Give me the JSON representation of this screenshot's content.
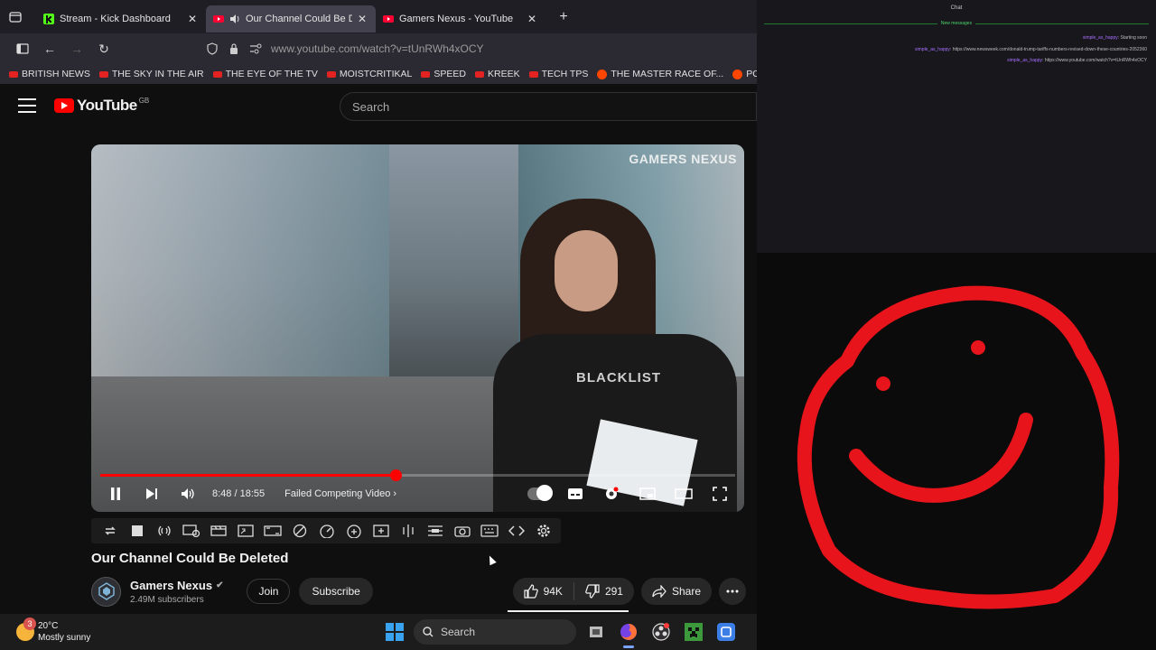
{
  "browser": {
    "tabs": [
      {
        "label": "Stream - Kick Dashboard",
        "favicon": "kick-icon"
      },
      {
        "label": "Our Channel Could Be Deleted",
        "favicon": "youtube-icon",
        "audio": true
      },
      {
        "label": "Gamers Nexus - YouTube",
        "favicon": "youtube-icon"
      }
    ],
    "active_tab": 1,
    "url": "www.youtube.com/watch?v=tUnRWh4xOCY",
    "bookmarks": [
      {
        "label": "BRITISH NEWS",
        "icon": "youtube"
      },
      {
        "label": "THE SKY IN THE AIR",
        "icon": "youtube"
      },
      {
        "label": "THE EYE OF THE TV",
        "icon": "youtube"
      },
      {
        "label": "MOISTCRITIKAL",
        "icon": "youtube"
      },
      {
        "label": "SPEED",
        "icon": "youtube"
      },
      {
        "label": "KREEK",
        "icon": "youtube"
      },
      {
        "label": "TECH TPS",
        "icon": "youtube"
      },
      {
        "label": "THE MASTER RACE OF...",
        "icon": "reddit"
      },
      {
        "label": "POLITICAL STUFF",
        "icon": "reddit"
      }
    ]
  },
  "youtube": {
    "logo_text": "YouTube",
    "country": "GB",
    "search_placeholder": "Search",
    "player": {
      "watermark": "GAMERS NEXUS",
      "shirt_text": "BLACKLIST",
      "time": "8:48 / 18:55",
      "chapter": "Failed Competing Video",
      "progress_fraction": 0.465
    },
    "video": {
      "title": "Our Channel Could Be Deleted",
      "channel": "Gamers Nexus",
      "subscribers": "2.49M subscribers",
      "join_label": "Join",
      "subscribe_label": "Subscribe",
      "likes": "94K",
      "dislikes": "291",
      "share_label": "Share"
    }
  },
  "chat": {
    "title": "Chat",
    "new_messages": "New messages",
    "lines": [
      {
        "user": "simple_as_happy",
        "text": "Starting soon"
      },
      {
        "user": "simple_as_happy",
        "text": "https://www.newsweek.com/donald-trump-tariffs-numbers-revised-down-these-countries-2052360"
      },
      {
        "user": "simple_as_happy",
        "text": "https://www.youtube.com/watch?v=tUnRWh4xOCY"
      }
    ]
  },
  "taskbar": {
    "temperature": "20°C",
    "weather": "Mostly sunny",
    "weather_badge": "3",
    "search_label": "Search"
  },
  "colors": {
    "accent_red": "#ff0000",
    "face_red": "#e8141b",
    "windows_blue": "#3aa3f0"
  }
}
